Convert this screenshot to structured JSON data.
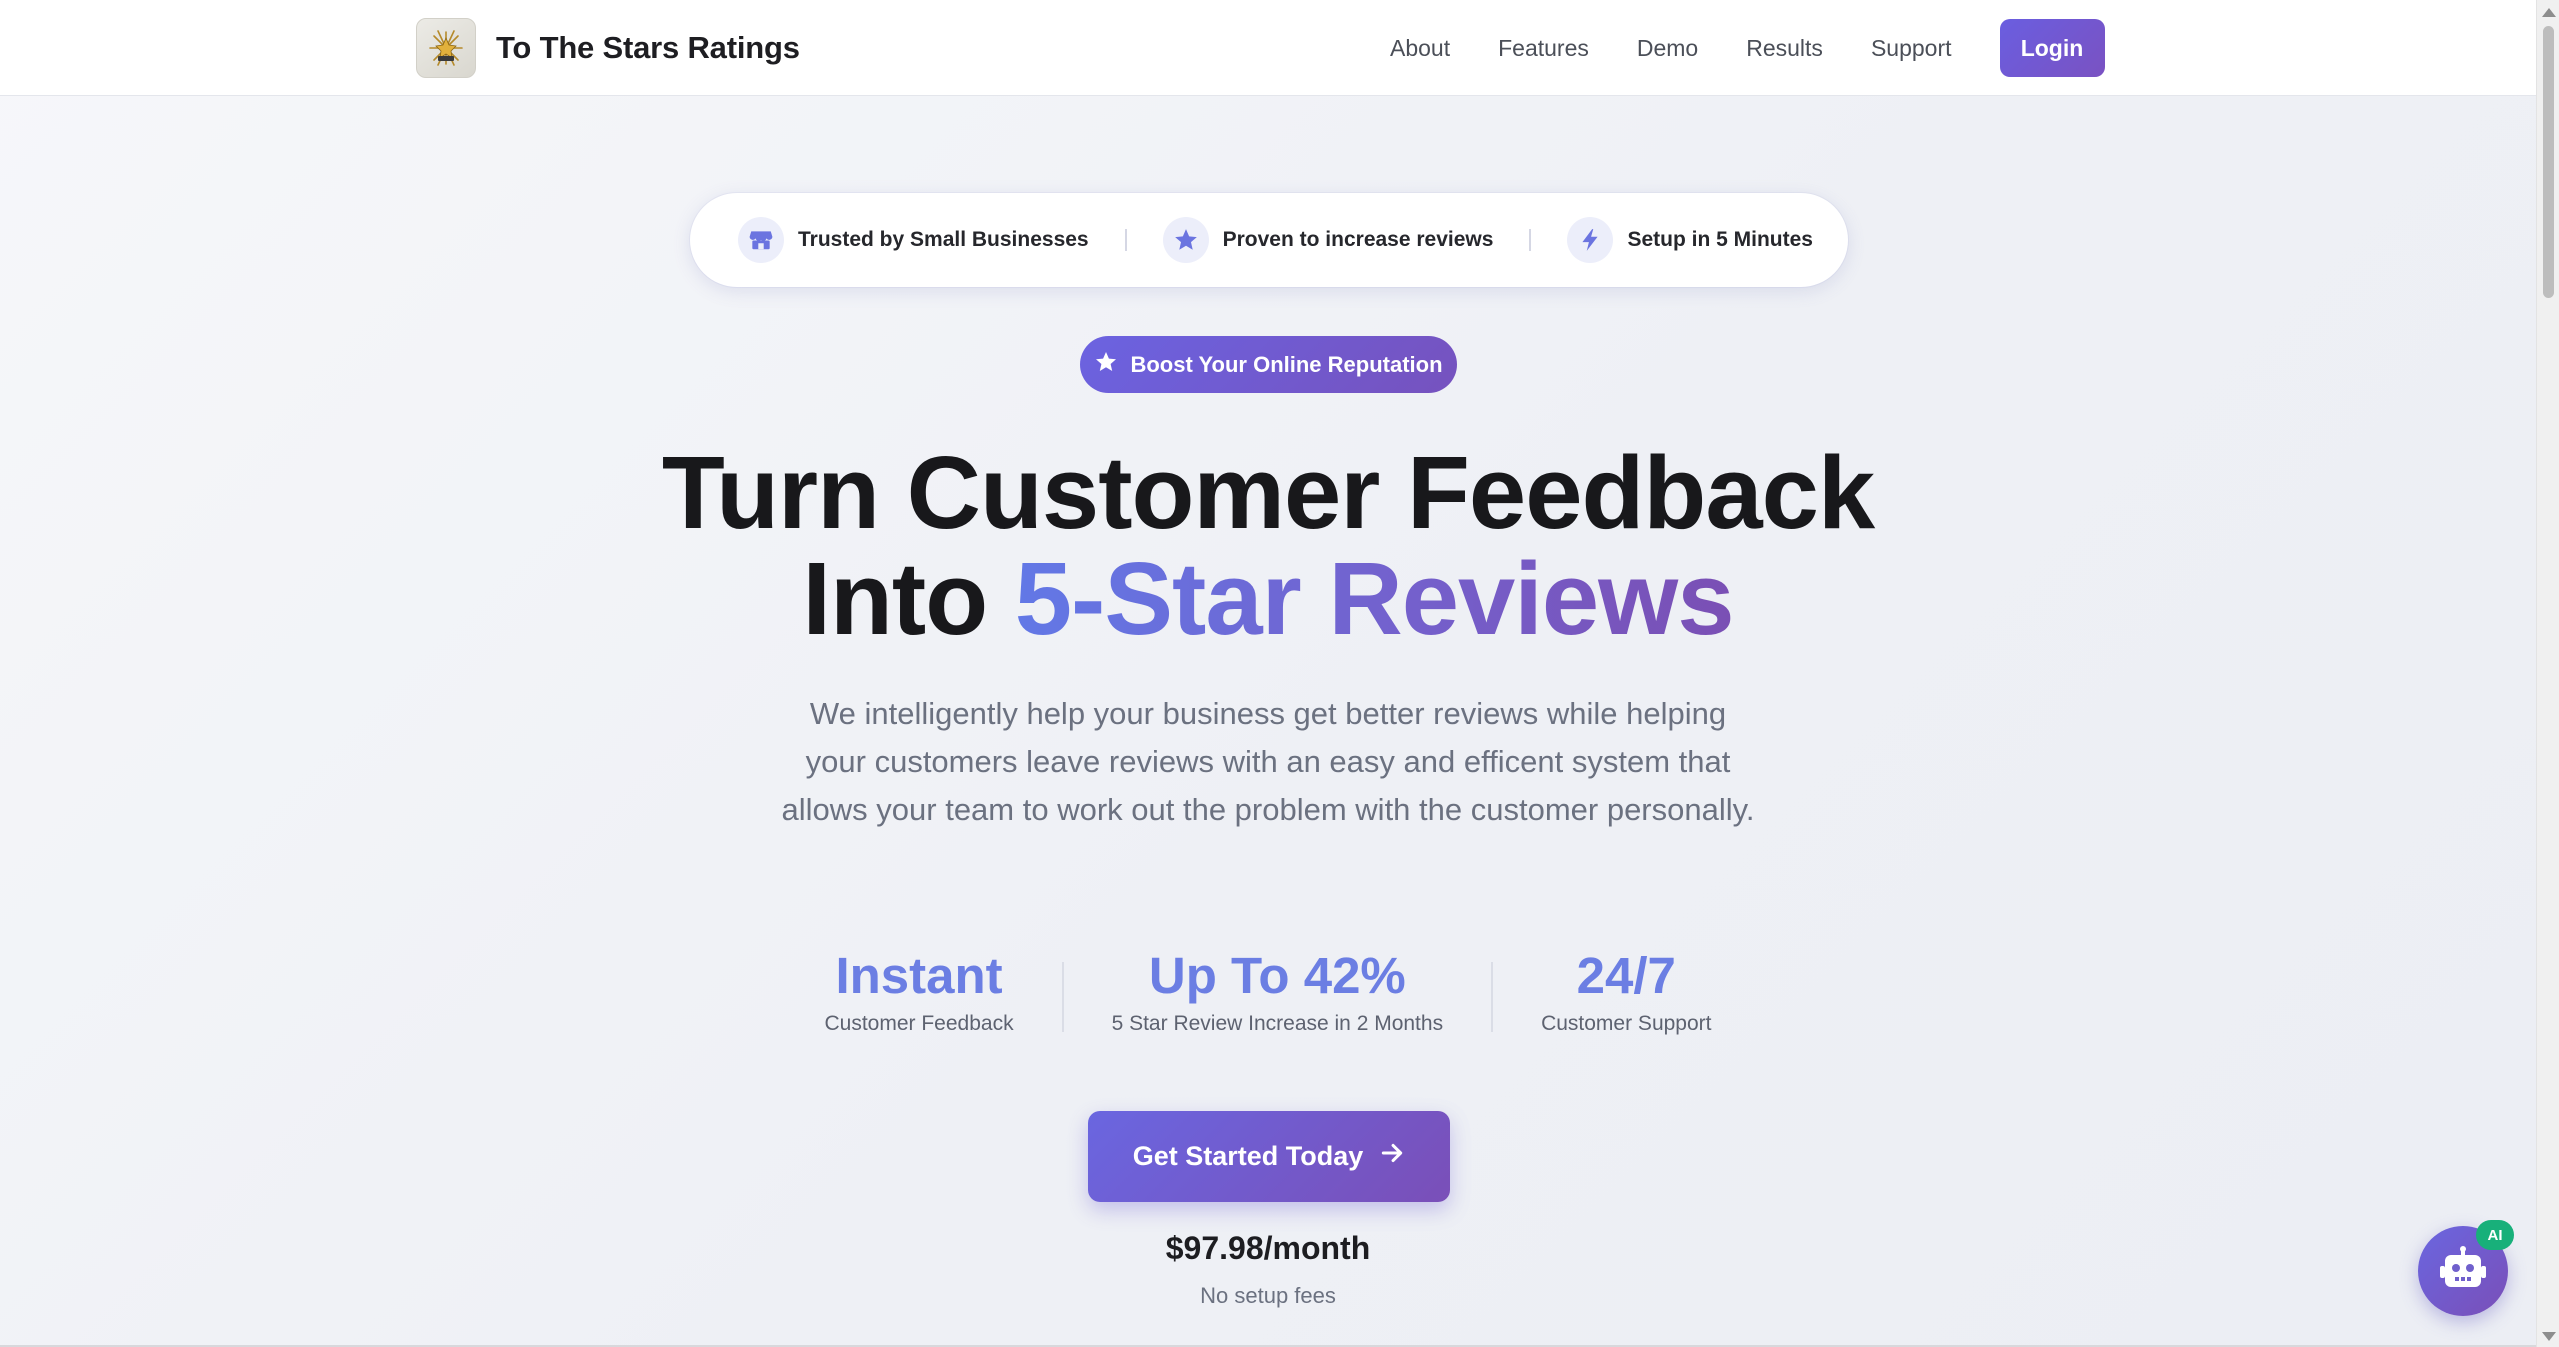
{
  "brand": {
    "name": "To The Stars Ratings",
    "logo_icon": "starburst-logo-icon"
  },
  "nav": {
    "links": [
      "About",
      "Features",
      "Demo",
      "Results",
      "Support"
    ],
    "login_label": "Login"
  },
  "trust": {
    "items": [
      {
        "icon": "store-icon",
        "label": "Trusted by Small Businesses"
      },
      {
        "icon": "star-icon",
        "label": "Proven to increase reviews"
      },
      {
        "icon": "lightning-icon",
        "label": "Setup in 5 Minutes"
      }
    ]
  },
  "badge": {
    "icon": "star-icon",
    "label": "Boost Your Online Reputation"
  },
  "hero": {
    "headline_line1": "Turn Customer Feedback",
    "headline_line2_prefix": "Into ",
    "headline_line2_highlight": "5-Star Reviews",
    "description": "We intelligently help your business get better reviews while helping your customers leave reviews with an easy and efficent system that allows your team to work out the problem with the customer personally."
  },
  "stats": [
    {
      "value": "Instant",
      "label": "Customer Feedback"
    },
    {
      "value": "Up To 42%",
      "label": "5 Star Review Increase in 2 Months"
    },
    {
      "value": "24/7",
      "label": "Customer Support"
    }
  ],
  "cta": {
    "label": "Get Started Today",
    "icon": "arrow-right-icon"
  },
  "pricing": {
    "price": "$97.98/month",
    "note": "No setup fees"
  },
  "assistant": {
    "icon": "robot-icon",
    "tag": "AI"
  },
  "colors": {
    "accent_start": "#6a66e0",
    "accent_end": "#7a4fb8",
    "stat_blue": "#6b7ee3",
    "ai_tag_green": "#18b07a"
  }
}
